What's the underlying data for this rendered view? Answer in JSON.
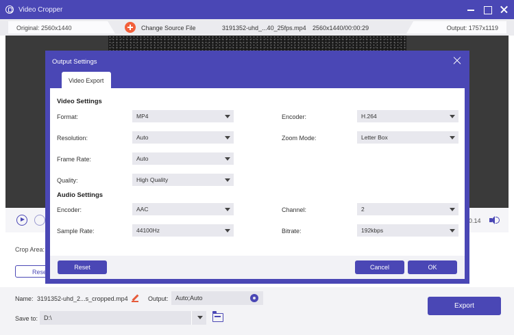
{
  "window": {
    "title": "Video Cropper"
  },
  "info_bar": {
    "original": "Original: 2560x1440",
    "change_source": "Change Source File",
    "file_name": "3191352-uhd_...40_25fps.mp4",
    "file_meta": "2560x1440/00:00:29",
    "output": "Output: 1757x1119"
  },
  "controls": {
    "time_end": "0.14"
  },
  "crop_panel": {
    "crop_area_label": "Crop Area:",
    "reset_label": "Rese"
  },
  "footer": {
    "name_label": "Name:",
    "name_value": "3191352-uhd_2...s_cropped.mp4",
    "output_label": "Output:",
    "output_value": "Auto;Auto",
    "save_to_label": "Save to:",
    "save_to_value": "D:\\",
    "export_label": "Export"
  },
  "modal": {
    "title": "Output Settings",
    "tab": "Video Export",
    "video_section": "Video Settings",
    "audio_section": "Audio Settings",
    "fields": {
      "format": {
        "label": "Format:",
        "value": "MP4"
      },
      "encoder": {
        "label": "Encoder:",
        "value": "H.264"
      },
      "resolution": {
        "label": "Resolution:",
        "value": "Auto"
      },
      "zoom_mode": {
        "label": "Zoom Mode:",
        "value": "Letter Box"
      },
      "frame_rate": {
        "label": "Frame Rate:",
        "value": "Auto"
      },
      "quality": {
        "label": "Quality:",
        "value": "High Quality"
      },
      "audio_encoder": {
        "label": "Encoder:",
        "value": "AAC"
      },
      "channel": {
        "label": "Channel:",
        "value": "2"
      },
      "sample_rate": {
        "label": "Sample Rate:",
        "value": "44100Hz"
      },
      "bitrate": {
        "label": "Bitrate:",
        "value": "192kbps"
      }
    },
    "buttons": {
      "reset": "Reset",
      "cancel": "Cancel",
      "ok": "OK"
    }
  },
  "colors": {
    "accent": "#4a47b5",
    "orange": "#f25f3a"
  }
}
